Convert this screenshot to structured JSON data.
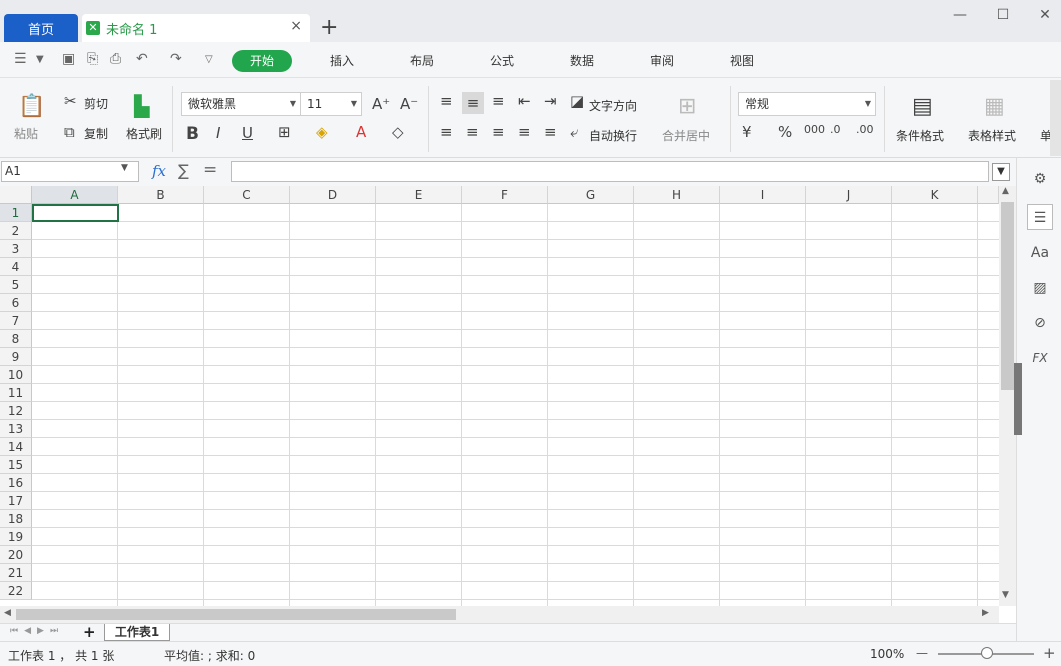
{
  "titlebar": {
    "home_tab": "首页",
    "doc_tab": "未命名 1",
    "close": "×",
    "add": "+",
    "min": "—",
    "max": "☐",
    "closewin": "✕"
  },
  "menubar": {
    "hamburger": "☰",
    "items": [
      "开始",
      "插入",
      "布局",
      "公式",
      "数据",
      "审阅",
      "视图"
    ]
  },
  "ribbon": {
    "paste": "粘贴",
    "cut": "剪切",
    "copy": "复制",
    "format_painter": "格式刷",
    "font_name": "微软雅黑",
    "font_size": "11",
    "text_direction": "文字方向",
    "wrap_text": "自动换行",
    "merge_center": "合并居中",
    "number_format": "常规",
    "conditional_format": "条件格式",
    "table_style": "表格样式",
    "cell_cut": "单"
  },
  "formula_bar": {
    "cell_ref": "A1",
    "fx": "fx",
    "sum": "∑",
    "eq": "="
  },
  "grid": {
    "columns": [
      "A",
      "B",
      "C",
      "D",
      "E",
      "F",
      "G",
      "H",
      "I",
      "J",
      "K"
    ],
    "rows": [
      "1",
      "2",
      "3",
      "4",
      "5",
      "6",
      "7",
      "8",
      "9",
      "10",
      "11",
      "12",
      "13",
      "14",
      "15",
      "16",
      "17",
      "18",
      "19",
      "20",
      "21",
      "22"
    ]
  },
  "sheets": {
    "add": "+",
    "tab": "工作表1"
  },
  "status": {
    "sheet_count": "工作表 1 ， 共 1 张",
    "stats": "平均值: ; 求和: 0",
    "zoom": "100%",
    "minus": "—",
    "plus": "+"
  },
  "side_panel": {
    "fx": "FX"
  }
}
